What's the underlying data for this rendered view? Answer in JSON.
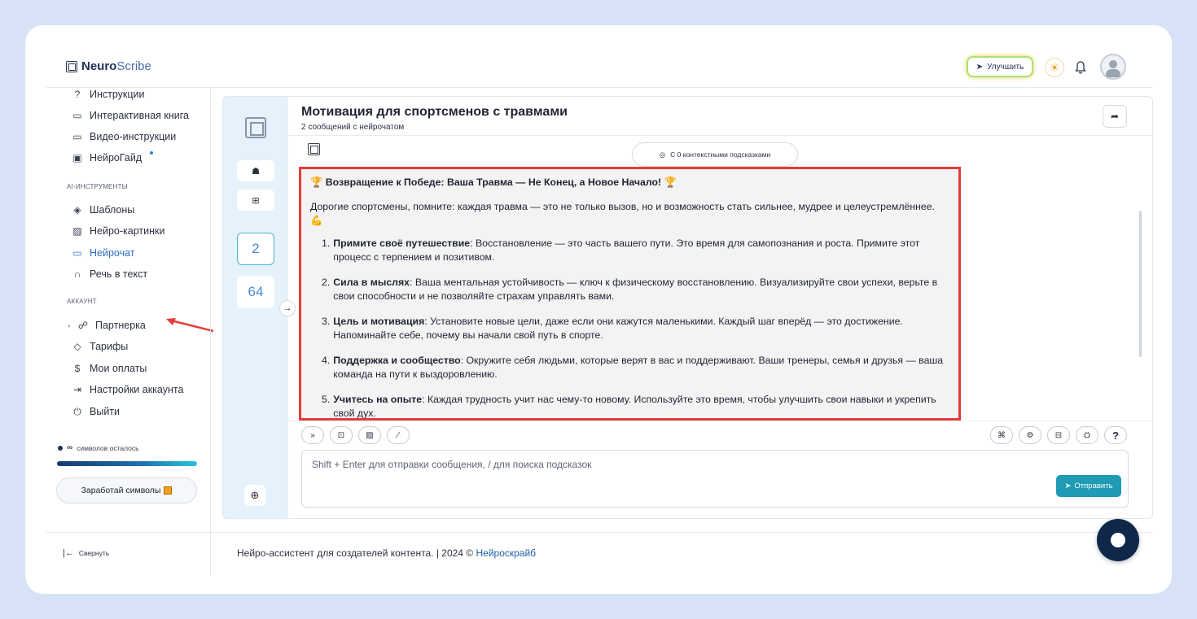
{
  "brand": {
    "name_bold": "Neuro",
    "name_light": "Scribe"
  },
  "header": {
    "upgrade_label": "Улучшить"
  },
  "sidebar": {
    "items_top": [
      {
        "label": "Инструкции",
        "icon": "help-circle-icon"
      },
      {
        "label": "Интерактивная книга",
        "icon": "book-icon"
      },
      {
        "label": "Видео-инструкции",
        "icon": "video-icon"
      },
      {
        "label": "НейроГайд",
        "icon": "guide-icon"
      }
    ],
    "section_ai": "AI-ИНСТРУМЕНТЫ",
    "items_ai": [
      {
        "label": "Шаблоны",
        "icon": "layers-icon"
      },
      {
        "label": "Нейро-картинки",
        "icon": "image-icon"
      },
      {
        "label": "Нейрочат",
        "icon": "chat-icon"
      },
      {
        "label": "Речь в текст",
        "icon": "headphones-icon"
      }
    ],
    "section_account": "АККАУНТ",
    "items_account": [
      {
        "label": "Партнерка",
        "icon": "users-icon"
      },
      {
        "label": "Тарифы",
        "icon": "tag-icon"
      },
      {
        "label": "Мои оплаты",
        "icon": "dollar-icon"
      },
      {
        "label": "Настройки аккаунта",
        "icon": "login-icon"
      },
      {
        "label": "Выйти",
        "icon": "power-icon"
      }
    ],
    "chars_symbol": "∞",
    "chars_left": "символов осталось",
    "earn_label": "Заработай символы",
    "collapse_label": "Свернуть"
  },
  "chat": {
    "title": "Мотивация для спортсменов с травмами",
    "subtitle": "2 сообщений с нейрочатом",
    "context_pill": "С 0 контекстными подсказками",
    "counter_chats": "2",
    "counter_other": "64",
    "message": {
      "heading": "Возвращение к Победе: Ваша Травма — Не Конец, а Новое Начало!",
      "intro": "Дорогие спортсмены, помните: каждая травма — это не только вызов, но и возможность стать сильнее, мудрее и целеустремлённее.",
      "items": [
        {
          "num": "1.",
          "title": "Примите своё путешествие",
          "text": ": Восстановление — это часть вашего пути. Это время для самопознания и роста. Примите этот процесс с терпением и позитивом."
        },
        {
          "num": "2.",
          "title": "Сила в мыслях",
          "text": ": Ваша ментальная устойчивость — ключ к физическому восстановлению. Визуализируйте свои успехи, верьте в свои способности и не позволяйте страхам управлять вами."
        },
        {
          "num": "3.",
          "title": "Цель и мотивация",
          "text": ": Установите новые цели, даже если они кажутся маленькими. Каждый шаг вперёд — это достижение. Напоминайте себе, почему вы начали свой путь в спорте."
        },
        {
          "num": "4.",
          "title": "Поддержка и сообщество",
          "text": ": Окружите себя людьми, которые верят в вас и поддерживают. Ваши тренеры, семья и друзья — ваша команда на пути к выздоровлению."
        },
        {
          "num": "5.",
          "title": "Учитесь на опыте",
          "text": ": Каждая трудность учит нас чему-то новому. Используйте это время, чтобы улучшить свои навыки и укрепить свой дух."
        }
      ]
    },
    "input_placeholder": "Shift + Enter для отправки сообщения, / для поиска подсказок",
    "send_label": "Отправить",
    "help_label": "?"
  },
  "footer": {
    "text": "Нейро-ассистент для создателей контента.  | 2024 ©",
    "link": "Нейроскрайб"
  },
  "colors": {
    "accent": "#2d6cc9",
    "send": "#1f9bb5",
    "highlight_border": "#e53b3b",
    "chat_fab": "#0f2748"
  }
}
